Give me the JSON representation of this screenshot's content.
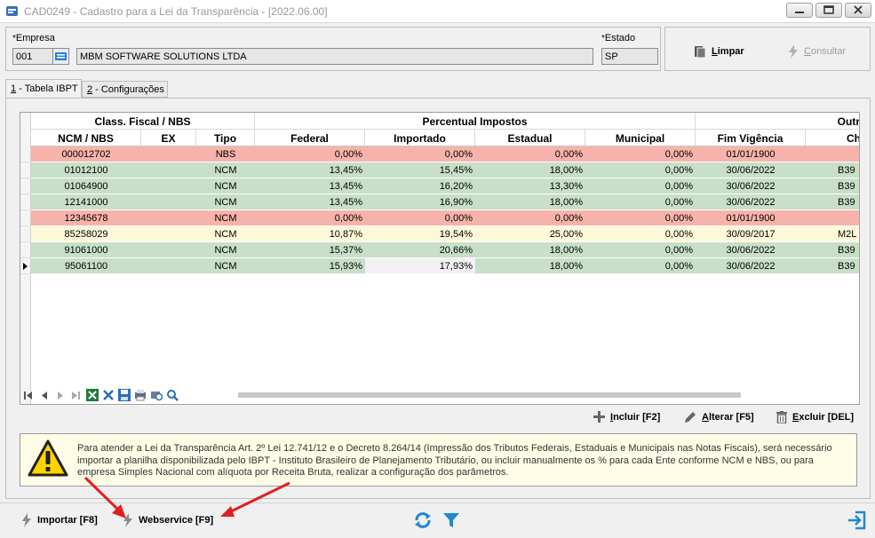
{
  "window": {
    "title": "CAD0249 - Cadastro para a Lei da Transparência - [2022.06.00]"
  },
  "header": {
    "empresa_label": "Empresa",
    "empresa_code": "001",
    "empresa_name": "MBM SOFTWARE SOLUTIONS LTDA",
    "estado_label": "Estado",
    "estado_value": "SP",
    "required_mark": "*"
  },
  "actions": {
    "limpar": "Limpar",
    "consultar": "Consultar"
  },
  "tabs": [
    {
      "label": "1 - Tabela IBPT"
    },
    {
      "label": "2 - Configurações"
    }
  ],
  "grid": {
    "groups": [
      "Class. Fiscal / NBS",
      "Percentual Impostos",
      "Outros"
    ],
    "columns": [
      "NCM / NBS",
      "EX",
      "Tipo",
      "Federal",
      "Importado",
      "Estadual",
      "Municipal",
      "Fim Vigência",
      "Ch"
    ],
    "rows": [
      {
        "ncm": "000012702",
        "ex": "",
        "tipo": "NBS",
        "federal": "0,00%",
        "importado": "0,00%",
        "estadual": "0,00%",
        "municipal": "0,00%",
        "fim": "01/01/1900",
        "ch": "",
        "color": "red"
      },
      {
        "ncm": "01012100",
        "ex": "",
        "tipo": "NCM",
        "federal": "13,45%",
        "importado": "15,45%",
        "estadual": "18,00%",
        "municipal": "0,00%",
        "fim": "30/06/2022",
        "ch": "B39",
        "color": "green"
      },
      {
        "ncm": "01064900",
        "ex": "",
        "tipo": "NCM",
        "federal": "13,45%",
        "importado": "16,20%",
        "estadual": "13,30%",
        "municipal": "0,00%",
        "fim": "30/06/2022",
        "ch": "B39",
        "color": "green"
      },
      {
        "ncm": "12141000",
        "ex": "",
        "tipo": "NCM",
        "federal": "13,45%",
        "importado": "16,90%",
        "estadual": "18,00%",
        "municipal": "0,00%",
        "fim": "30/06/2022",
        "ch": "B39",
        "color": "green"
      },
      {
        "ncm": "12345678",
        "ex": "",
        "tipo": "NCM",
        "federal": "0,00%",
        "importado": "0,00%",
        "estadual": "0,00%",
        "municipal": "0,00%",
        "fim": "01/01/1900",
        "ch": "",
        "color": "red"
      },
      {
        "ncm": "85258029",
        "ex": "",
        "tipo": "NCM",
        "federal": "10,87%",
        "importado": "19,54%",
        "estadual": "25,00%",
        "municipal": "0,00%",
        "fim": "30/09/2017",
        "ch": "M2L",
        "color": "yellow"
      },
      {
        "ncm": "91061000",
        "ex": "",
        "tipo": "NCM",
        "federal": "15,37%",
        "importado": "20,66%",
        "estadual": "18,00%",
        "municipal": "0,00%",
        "fim": "30/06/2022",
        "ch": "B39",
        "color": "green"
      },
      {
        "ncm": "95061100",
        "ex": "",
        "tipo": "NCM",
        "federal": "15,93%",
        "importado": "17,93%",
        "estadual": "18,00%",
        "municipal": "0,00%",
        "fim": "30/06/2022",
        "ch": "B39",
        "color": "green"
      }
    ]
  },
  "crud": {
    "incluir": "Incluir [F2]",
    "alterar": "Alterar [F5]",
    "excluir": "Excluir [DEL]"
  },
  "notice": {
    "text": "Para atender a Lei da Transparência Art. 2º Lei 12.741/12 e o Decreto 8.264/14 (Impressão dos Tributos Federais, Estaduais e Municipais nas Notas Fiscais), será necessário importar a planilha disponibilizada pelo IBPT - Instituto Brasileiro de Planejamento Tributário, ou incluir manualmente os % para cada Ente conforme NCM e NBS, ou para empresa Simples Nacional com alíquota por Receita Bruta, realizar a configuração dos parâmetros."
  },
  "footer": {
    "importar": "Importar [F8]",
    "webservice": "Webservice [F9]"
  },
  "colors": {
    "row_red": "#f7b3ab",
    "row_green": "#c8dfc8",
    "row_yellow": "#fff8d8",
    "arrow_red": "#e02020",
    "accent_blue": "#1e88d6"
  },
  "icons": [
    "app-icon",
    "lookup-icon",
    "clipboard-icon",
    "lightning-icon",
    "plus-icon",
    "pencil-icon",
    "trash-icon",
    "warning-icon",
    "refresh-icon",
    "filter-icon",
    "exit-icon",
    "excel-icon",
    "tools-icon",
    "save-icon",
    "print-icon",
    "search-icon"
  ]
}
